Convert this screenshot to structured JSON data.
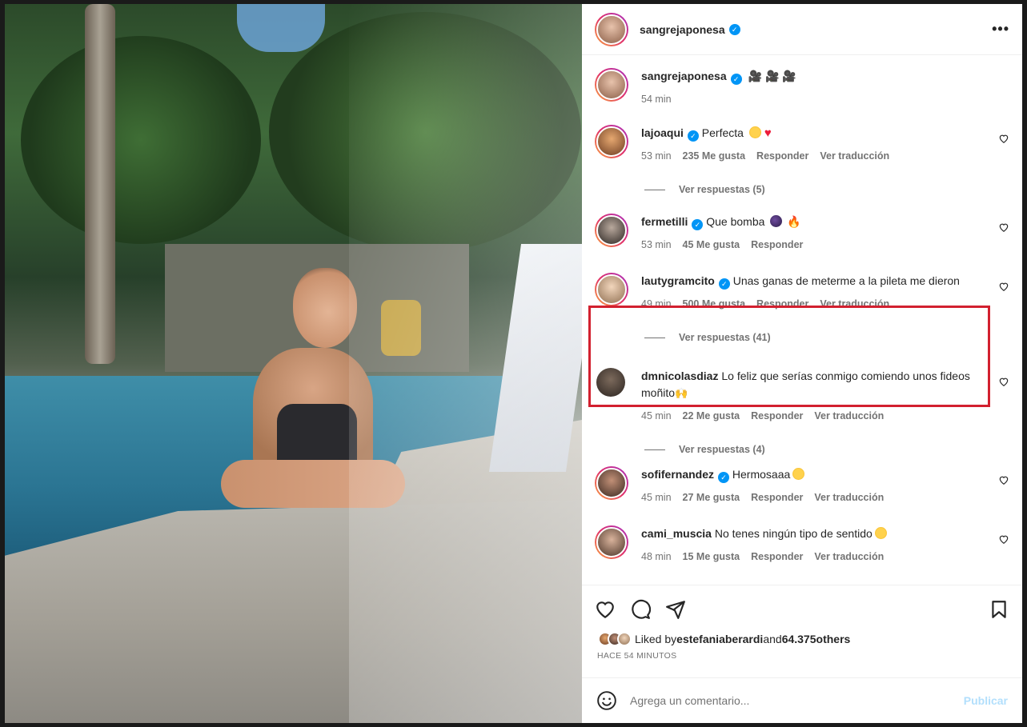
{
  "post": {
    "author": "sangrejaponesa",
    "verified": true
  },
  "caption": {
    "username": "sangrejaponesa",
    "time": "54 min",
    "emoji_name": "movie-camera-emoji"
  },
  "comments": [
    {
      "username": "lajoaqui",
      "verified": true,
      "text": "Perfecta",
      "time": "53 min",
      "likes": "235 Me gusta",
      "reply": "Responder",
      "translate": "Ver traducción",
      "replies": "Ver respuestas (5)"
    },
    {
      "username": "fermetilli",
      "verified": true,
      "text": "Que bomba",
      "time": "53 min",
      "likes": "45 Me gusta",
      "reply": "Responder"
    },
    {
      "username": "lautygramcito",
      "verified": true,
      "text": "Unas ganas de meterme a la pileta me dieron",
      "time": "49 min",
      "likes": "500 Me gusta",
      "reply": "Responder",
      "translate": "Ver traducción",
      "replies": "Ver respuestas (41)",
      "highlighted": true
    },
    {
      "username": "dmnicolasdiaz",
      "verified": false,
      "text": "Lo feliz que serías conmigo comiendo unos fideos moñito",
      "time": "45 min",
      "likes": "22 Me gusta",
      "reply": "Responder",
      "translate": "Ver traducción",
      "replies": "Ver respuestas (4)"
    },
    {
      "username": "sofifernandez",
      "verified": true,
      "text": "Hermosaaa",
      "time": "45 min",
      "likes": "27 Me gusta",
      "reply": "Responder",
      "translate": "Ver traducción"
    },
    {
      "username": "cami_muscia",
      "verified": false,
      "text": "No tenes ningún tipo de sentido",
      "time": "48 min",
      "likes": "15 Me gusta",
      "reply": "Responder",
      "translate": "Ver traducción"
    }
  ],
  "likes_bar": {
    "prefix": "Liked by ",
    "user": "estefaniaberardi",
    "middle": " and ",
    "count": "64.375",
    "suffix": " others",
    "time_ago": "HACE 54 MINUTOS"
  },
  "comment_input": {
    "placeholder": "Agrega un comentario...",
    "publish": "Publicar"
  },
  "colors": {
    "verified": "#0095f6",
    "highlight_border": "#d2202f",
    "publish_disabled": "#b2dffc"
  }
}
